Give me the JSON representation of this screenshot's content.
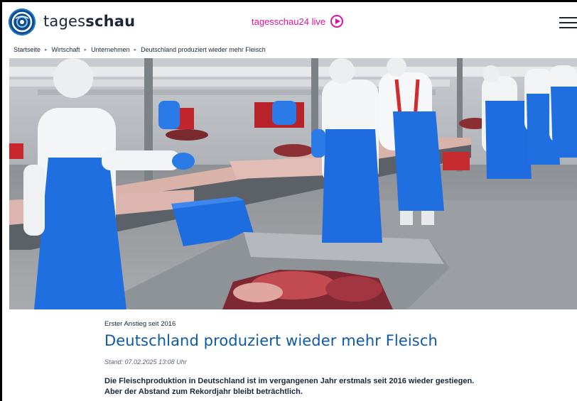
{
  "header": {
    "brand_light": "tages",
    "brand_bold": "schau",
    "live_label": "tagesschau24 live"
  },
  "breadcrumb": {
    "items": [
      "Startseite",
      "Wirtschaft",
      "Unternehmen",
      "Deutschland produziert wieder mehr Fleisch"
    ]
  },
  "article": {
    "kicker": "Erster Anstieg seit 2016",
    "headline": "Deutschland produziert wieder mehr Fleisch",
    "stand": "Stand: 07.02.2025 13:08 Uhr",
    "lead": "Die Fleischproduktion in Deutschland ist im vergangenen Jahr erstmals seit 2016 wieder gestiegen. Aber der Abstand zum Rekordjahr bleibt beträchtlich."
  },
  "colors": {
    "accent_pink": "#e3119e",
    "headline_blue": "#0f5aa6",
    "logo_blue": "#0b4a8d"
  },
  "icons": {
    "logo": "tagesschau-logo-icon",
    "play": "play-circle-icon",
    "menu": "hamburger-menu-icon"
  }
}
